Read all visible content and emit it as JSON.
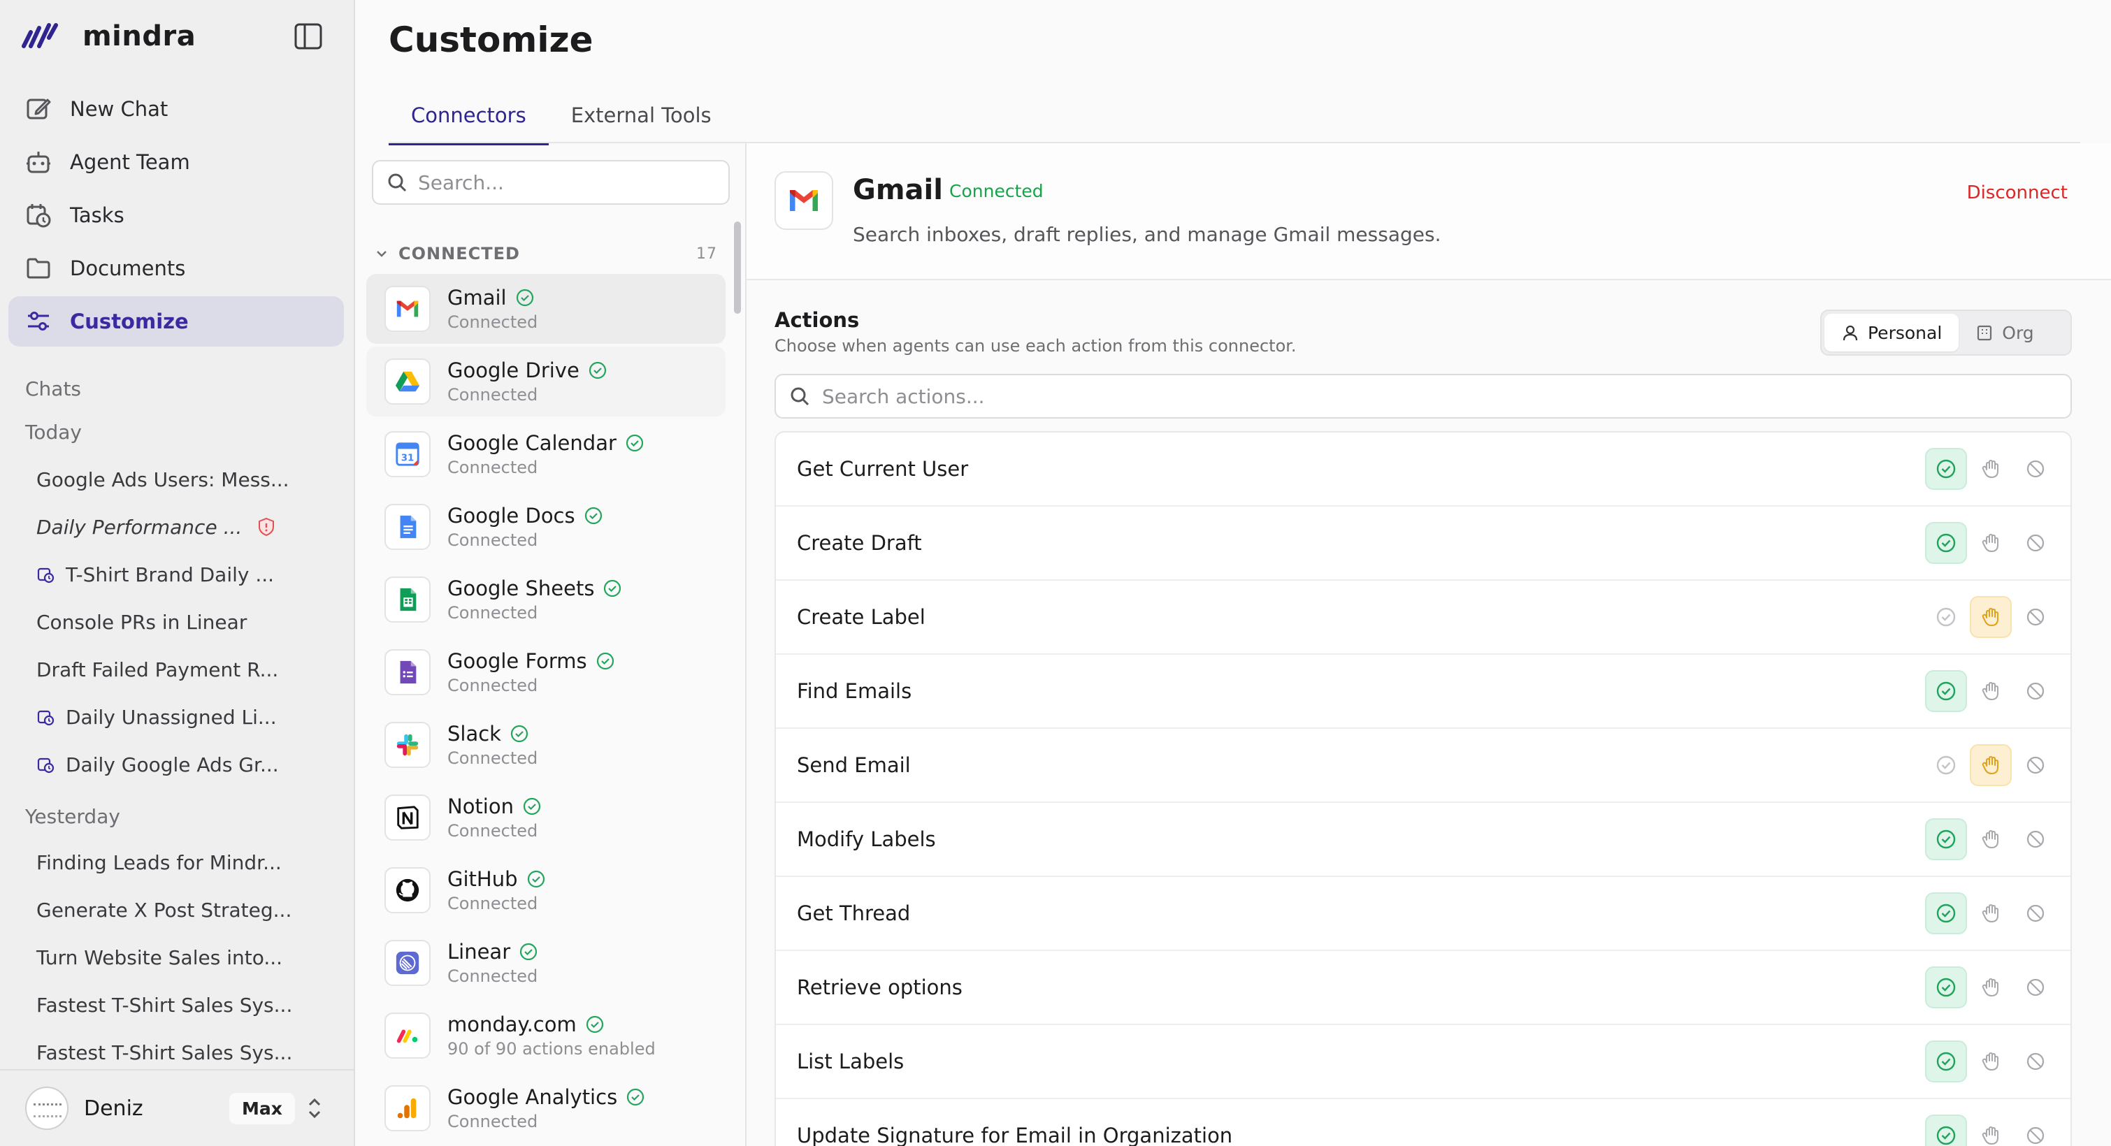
{
  "brand": {
    "name": "mindra"
  },
  "nav": [
    {
      "label": "New Chat",
      "icon": "edit-icon"
    },
    {
      "label": "Agent Team",
      "icon": "bot-icon"
    },
    {
      "label": "Tasks",
      "icon": "calendar-clock-icon"
    },
    {
      "label": "Documents",
      "icon": "folder-icon"
    },
    {
      "label": "Customize",
      "icon": "sliders-icon",
      "active": true
    }
  ],
  "chats": {
    "heading": "Chats",
    "today_label": "Today",
    "today": [
      {
        "label": "Google Ads Users: Mess..."
      },
      {
        "label": "Daily Performance ...",
        "italic": true,
        "warning": true
      },
      {
        "label": "T-Shirt Brand Daily ...",
        "scheduled": true
      },
      {
        "label": "Console PRs in Linear"
      },
      {
        "label": "Draft Failed Payment R..."
      },
      {
        "label": "Daily Unassigned Li...",
        "scheduled": true
      },
      {
        "label": "Daily Google Ads Gr...",
        "scheduled": true
      }
    ],
    "yesterday_label": "Yesterday",
    "yesterday": [
      {
        "label": "Finding Leads for Mindr..."
      },
      {
        "label": "Generate X Post Strateg..."
      },
      {
        "label": "Turn Website Sales into..."
      },
      {
        "label": "Fastest T-Shirt Sales Sys..."
      },
      {
        "label": "Fastest T-Shirt Sales Sys..."
      }
    ]
  },
  "user": {
    "name": "Deniz",
    "plan": "Max"
  },
  "page": {
    "title": "Customize",
    "tabs": [
      {
        "label": "Connectors",
        "active": true
      },
      {
        "label": "External Tools"
      }
    ]
  },
  "connectors": {
    "search_placeholder": "Search...",
    "group_label": "CONNECTED",
    "group_count": "17",
    "items": [
      {
        "name": "Gmail",
        "status": "Connected",
        "icon": "gmail-icon"
      },
      {
        "name": "Google Drive",
        "status": "Connected",
        "icon": "google-drive-icon"
      },
      {
        "name": "Google Calendar",
        "status": "Connected",
        "icon": "google-calendar-icon"
      },
      {
        "name": "Google Docs",
        "status": "Connected",
        "icon": "google-docs-icon"
      },
      {
        "name": "Google Sheets",
        "status": "Connected",
        "icon": "google-sheets-icon"
      },
      {
        "name": "Google Forms",
        "status": "Connected",
        "icon": "google-forms-icon"
      },
      {
        "name": "Slack",
        "status": "Connected",
        "icon": "slack-icon"
      },
      {
        "name": "Notion",
        "status": "Connected",
        "icon": "notion-icon"
      },
      {
        "name": "GitHub",
        "status": "Connected",
        "icon": "github-icon"
      },
      {
        "name": "Linear",
        "status": "Connected",
        "icon": "linear-icon"
      },
      {
        "name": "monday.com",
        "status": "90 of 90 actions enabled",
        "icon": "monday-icon"
      },
      {
        "name": "Google Analytics",
        "status": "Connected",
        "icon": "google-analytics-icon"
      }
    ]
  },
  "detail": {
    "name": "Gmail",
    "status": "Connected",
    "description": "Search inboxes, draft replies, and manage Gmail messages.",
    "disconnect_label": "Disconnect",
    "actions_title": "Actions",
    "actions_subtitle": "Choose when agents can use each action from this connector.",
    "scope_personal": "Personal",
    "scope_org": "Org",
    "actions_search_placeholder": "Search actions...",
    "actions": [
      {
        "name": "Get Current User",
        "mode": "allow"
      },
      {
        "name": "Create Draft",
        "mode": "allow"
      },
      {
        "name": "Create Label",
        "mode": "ask"
      },
      {
        "name": "Find Emails",
        "mode": "allow"
      },
      {
        "name": "Send Email",
        "mode": "ask"
      },
      {
        "name": "Modify Labels",
        "mode": "allow"
      },
      {
        "name": "Get Thread",
        "mode": "allow"
      },
      {
        "name": "Retrieve options",
        "mode": "allow"
      },
      {
        "name": "List Labels",
        "mode": "allow"
      },
      {
        "name": "Update Signature for Email in Organization",
        "mode": "allow"
      }
    ]
  },
  "colors": {
    "accent": "#2e2590",
    "connected_green": "#16a34a",
    "danger": "#dc2626",
    "allow_bg": "#dff5ea",
    "ask_bg": "#fdf0d2"
  }
}
